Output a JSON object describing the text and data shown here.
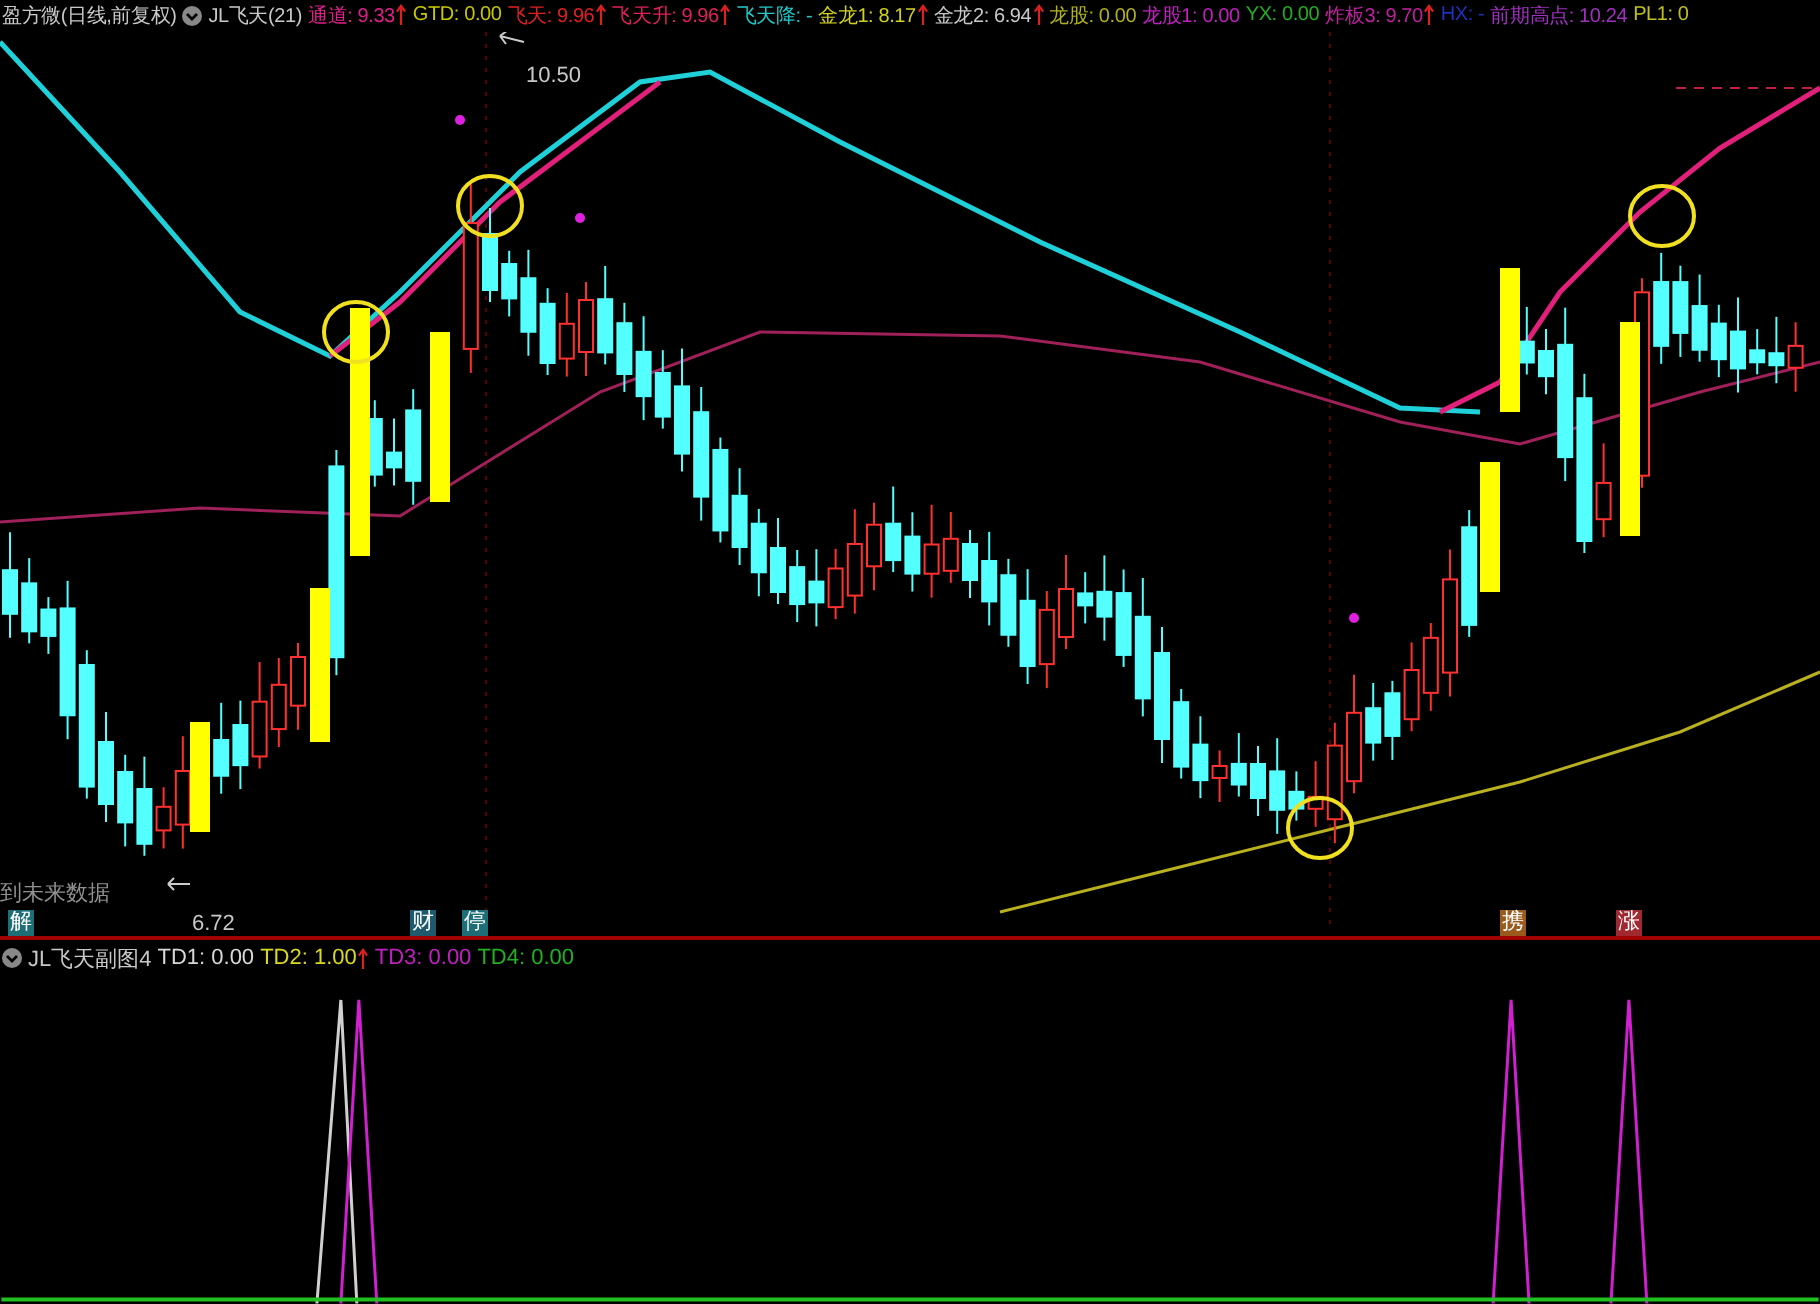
{
  "main_header": {
    "symbol": "盈方微(日线,前复权)",
    "indicator": "JL飞天(21)",
    "items": [
      {
        "text": "通道: 9.33",
        "color": "#e0208a",
        "arrow": true
      },
      {
        "text": "GTD: 0.00",
        "color": "#c8c800",
        "arrow": false
      },
      {
        "text": "飞天: 9.96",
        "color": "#e02020",
        "arrow": true
      },
      {
        "text": "飞天升: 9.96",
        "color": "#e0205a",
        "arrow": true
      },
      {
        "text": "飞天降: -",
        "color": "#20c8c8",
        "arrow": false
      },
      {
        "text": "金龙1: 8.17",
        "color": "#d0d020",
        "arrow": true
      },
      {
        "text": "金龙2: 6.94",
        "color": "#c8c8c8",
        "arrow": true
      },
      {
        "text": "龙股: 0.00",
        "color": "#b0b020",
        "arrow": false
      },
      {
        "text": "龙股1: 0.00",
        "color": "#c020c0",
        "arrow": false
      },
      {
        "text": "YX: 0.00",
        "color": "#20b020",
        "arrow": false
      },
      {
        "text": "炸板3: 9.70",
        "color": "#c020a0",
        "arrow": true
      },
      {
        "text": "HX: -",
        "color": "#2030c0",
        "arrow": false
      },
      {
        "text": "前期高点: 10.24",
        "color": "#a030c0",
        "arrow": false
      },
      {
        "text": "PL1: 0",
        "color": "#c0c020",
        "arrow": false
      }
    ]
  },
  "price_labels": {
    "high": "10.50",
    "low": "6.72"
  },
  "note": "到未来数据",
  "badges": [
    {
      "text": "解",
      "color": "#1e6e78"
    },
    {
      "text": "财",
      "color": "#1e5a6e"
    },
    {
      "text": "停",
      "color": "#1e6e78"
    },
    {
      "text": "携",
      "color": "#9a5a1e"
    },
    {
      "text": "涨",
      "color": "#a02830"
    }
  ],
  "sub_header": {
    "title": "JL飞天副图4",
    "items": [
      {
        "text": "TD1: 0.00",
        "color": "#d8d8d8",
        "arrow": false
      },
      {
        "text": "TD2: 1.00",
        "color": "#d8d820",
        "arrow": true
      },
      {
        "text": "TD3: 0.00",
        "color": "#c020c0",
        "arrow": false
      },
      {
        "text": "TD4: 0.00",
        "color": "#20b020",
        "arrow": false
      }
    ]
  }
}
